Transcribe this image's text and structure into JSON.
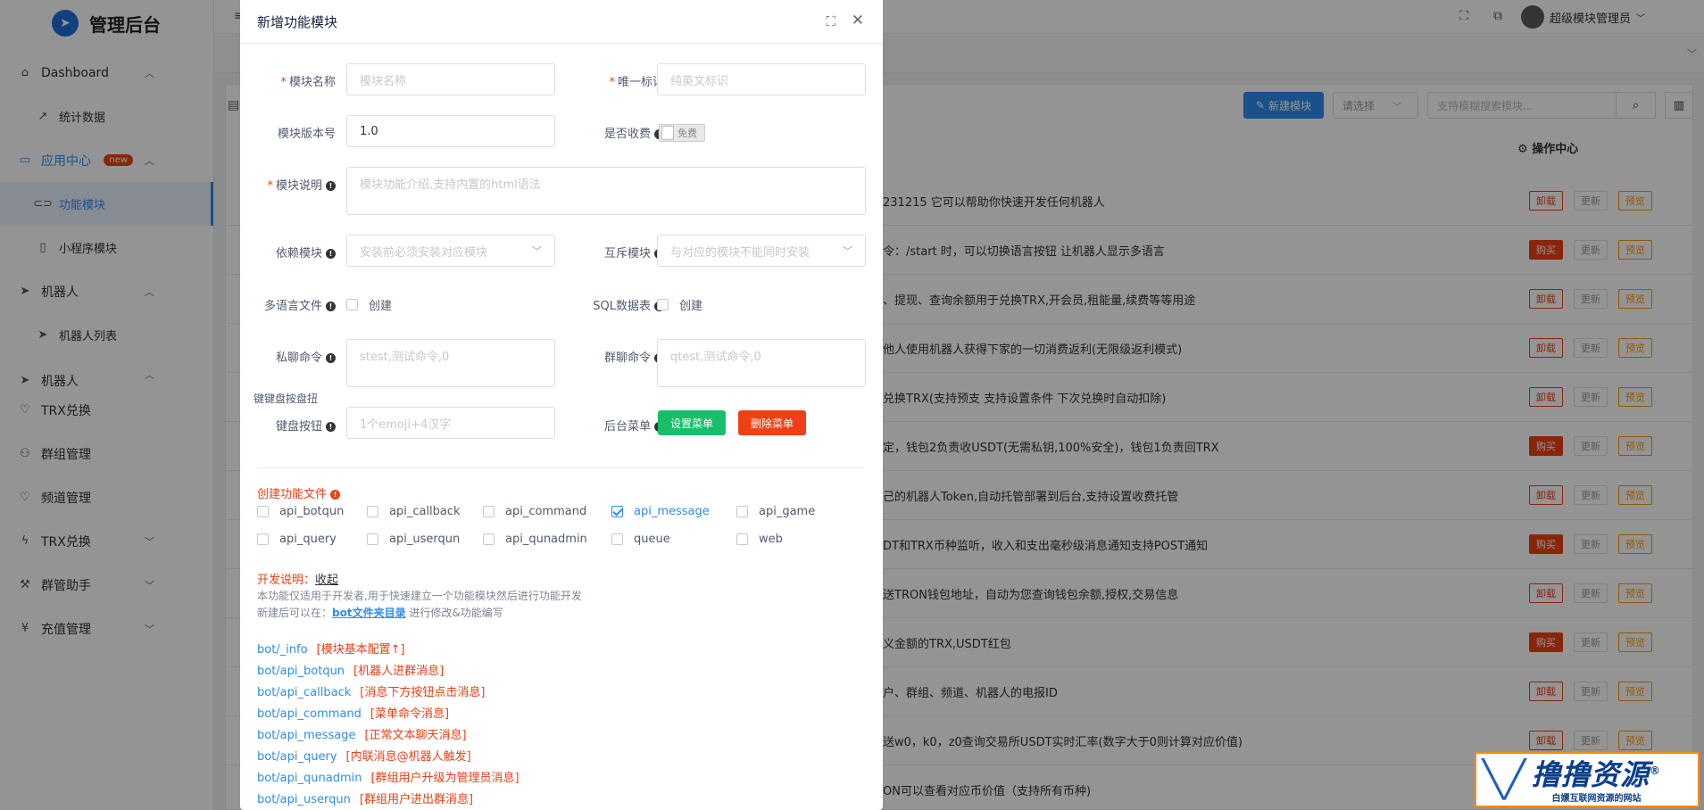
{
  "app": {
    "title": "管理后台"
  },
  "sidebar": {
    "items": [
      {
        "label": "Dashboard",
        "icon": "home-icon"
      },
      {
        "label": "统计数据",
        "icon": "trend-icon"
      },
      {
        "label": "应用中心",
        "icon": "store-icon",
        "badge": "new"
      },
      {
        "label": "功能模块",
        "icon": "toggle-icon"
      },
      {
        "label": "小程序模块",
        "icon": "doc-icon"
      },
      {
        "label": "机器人",
        "icon": "send-icon"
      },
      {
        "label": "机器人列表",
        "icon": "send-icon"
      },
      {
        "label": "机器人",
        "icon": "send-icon"
      },
      {
        "label": "TRX兑换",
        "icon": "heart-icon"
      },
      {
        "label": "群组管理",
        "icon": "user-icon"
      },
      {
        "label": "频道管理",
        "icon": "heart-icon"
      },
      {
        "label": "TRX兑换",
        "icon": "bolt-icon"
      },
      {
        "label": "群管助手",
        "icon": "tool-icon"
      },
      {
        "label": "充值管理",
        "icon": "yen-icon"
      }
    ]
  },
  "topbar": {
    "user_name": "超级模块管理员"
  },
  "list": {
    "new_button": "新建模块",
    "select_placeholder": "请选择",
    "search_placeholder": "支持模糊搜索模块...",
    "ops_header": "操作中心",
    "rows": [
      {
        "desc": "231215 它可以帮助你快速开发任何机器人",
        "ops": [
          "卸载",
          "更新",
          "预览"
        ],
        "first_red": false
      },
      {
        "desc": "令：/start 时，可以切换语言按钮 让机器人显示多语言",
        "ops": [
          "购买",
          "更新",
          "预览"
        ],
        "first_red": true
      },
      {
        "desc": "、提现、查询余额用于兑换TRX,开会员,租能量,续费等等用途",
        "ops": [
          "卸载",
          "更新",
          "预览"
        ],
        "first_red": false
      },
      {
        "desc": "他人使用机器人获得下家的一切消费返利(无限级返利模式)",
        "ops": [
          "卸载",
          "更新",
          "预览"
        ],
        "first_red": false
      },
      {
        "desc": "兑换TRX(支持预支 支持设置条件 下次兑换时自动扣除)",
        "ops": [
          "卸载",
          "更新",
          "预览"
        ],
        "first_red": false
      },
      {
        "desc": "定，钱包2负责收USDT(无需私钥,100%安全)，钱包1负责回TRX",
        "ops": [
          "购买",
          "更新",
          "预览"
        ],
        "first_red": true
      },
      {
        "desc": "己的机器人Token,自动托管部署到后台,支持设置收费托管",
        "ops": [
          "卸载",
          "更新",
          "预览"
        ],
        "first_red": false
      },
      {
        "desc": "DT和TRX币种监听，收入和支出毫秒级消息通知支持POST通知",
        "ops": [
          "购买",
          "更新",
          "预览"
        ],
        "first_red": true
      },
      {
        "desc": "送TRON钱包地址，自动为您查询钱包余额,授权,交易信息",
        "ops": [
          "卸载",
          "更新",
          "预览"
        ],
        "first_red": false
      },
      {
        "desc": "义金额的TRX,USDT红包",
        "ops": [
          "购买",
          "更新",
          "预览"
        ],
        "first_red": true
      },
      {
        "desc": "户、群组、频道、机器人的电报ID",
        "ops": [
          "卸载",
          "更新",
          "预览"
        ],
        "first_red": false
      },
      {
        "desc": "送w0，k0，z0查询交易所USDT实时汇率(数字大于0则计算对应价值)",
        "ops": [
          "卸载",
          "更新",
          "预览"
        ],
        "first_red": false
      },
      {
        "desc": "ON可以查看对应币价值（支持所有币种)",
        "ops": [
          "卸载",
          "更新",
          "预览"
        ],
        "first_red": false
      }
    ]
  },
  "modal": {
    "title": "新增功能模块",
    "fields": {
      "name_label": "模块名称",
      "name_placeholder": "模块名称",
      "uid_label": "唯一标识",
      "uid_placeholder": "纯英文标识",
      "version_label": "模块版本号",
      "version_value": "1.0",
      "charge_label": "是否收费",
      "charge_value": "免费",
      "desc_label": "模块说明",
      "desc_placeholder": "模块功能介绍,支持内置的html语法",
      "depend_label": "依赖模块",
      "depend_placeholder": "安装前必须安装对应模块",
      "mutex_label": "互斥模块",
      "mutex_placeholder": "与对应的模块不能同时安装",
      "lang_label": "多语言文件",
      "lang_check": "创建",
      "sql_label": "SQL数据表",
      "sql_check": "创建",
      "private_label": "私聊命令",
      "private_placeholder": "stest,测试命令,0",
      "group_label": "群聊命令",
      "group_placeholder": "qtest,测试命令,0",
      "keyboard_tip": "键键盘按盘扭",
      "keyboard_label": "键盘按钮",
      "keyboard_placeholder": "1个emoji+4汉字",
      "menu_label": "后台菜单",
      "menu_set_button": "设置菜单",
      "menu_delete_button": "删除菜单"
    },
    "files_title": "创建功能文件",
    "files": [
      {
        "label": "api_botqun",
        "checked": false
      },
      {
        "label": "api_callback",
        "checked": false
      },
      {
        "label": "api_command",
        "checked": false
      },
      {
        "label": "api_message",
        "checked": true
      },
      {
        "label": "api_game",
        "checked": false
      },
      {
        "label": "api_query",
        "checked": false
      },
      {
        "label": "api_userqun",
        "checked": false
      },
      {
        "label": "api_qunadmin",
        "checked": false
      },
      {
        "label": "queue",
        "checked": false
      },
      {
        "label": "web",
        "checked": false
      }
    ],
    "dev": {
      "title": "开发说明：",
      "collapse": "收起",
      "line1": "本功能仅适用于开发者,用于快速建立一个功能模块然后进行功能开发",
      "line2_prefix": "新建后可以在：",
      "line2_link": "bot文件夹目录",
      "line2_suffix": " 进行修改&功能编写"
    },
    "api_docs": [
      {
        "path": "bot/_info",
        "desc": "[模块基本配置↑]"
      },
      {
        "path": "bot/api_botqun",
        "desc": "[机器人进群消息]"
      },
      {
        "path": "bot/api_callback",
        "desc": "[消息下方按钮点击消息]"
      },
      {
        "path": "bot/api_command",
        "desc": "[菜单命令消息]"
      },
      {
        "path": "bot/api_message",
        "desc": "[正常文本聊天消息]"
      },
      {
        "path": "bot/api_query",
        "desc": "[内联消息@机器人触发]"
      },
      {
        "path": "bot/api_qunadmin",
        "desc": "[群组用户升级为管理员消息]"
      },
      {
        "path": "bot/api_userqun",
        "desc": "[群组用户进出群消息]"
      }
    ]
  },
  "watermark": {
    "title": "撸撸资源",
    "subtitle": "白嫖互联网资源的网站",
    "reg": "®"
  },
  "colors": {
    "primary": "#2d8cf0",
    "danger": "#ed4014",
    "success": "#19be6b",
    "warning": "#ff9900"
  }
}
